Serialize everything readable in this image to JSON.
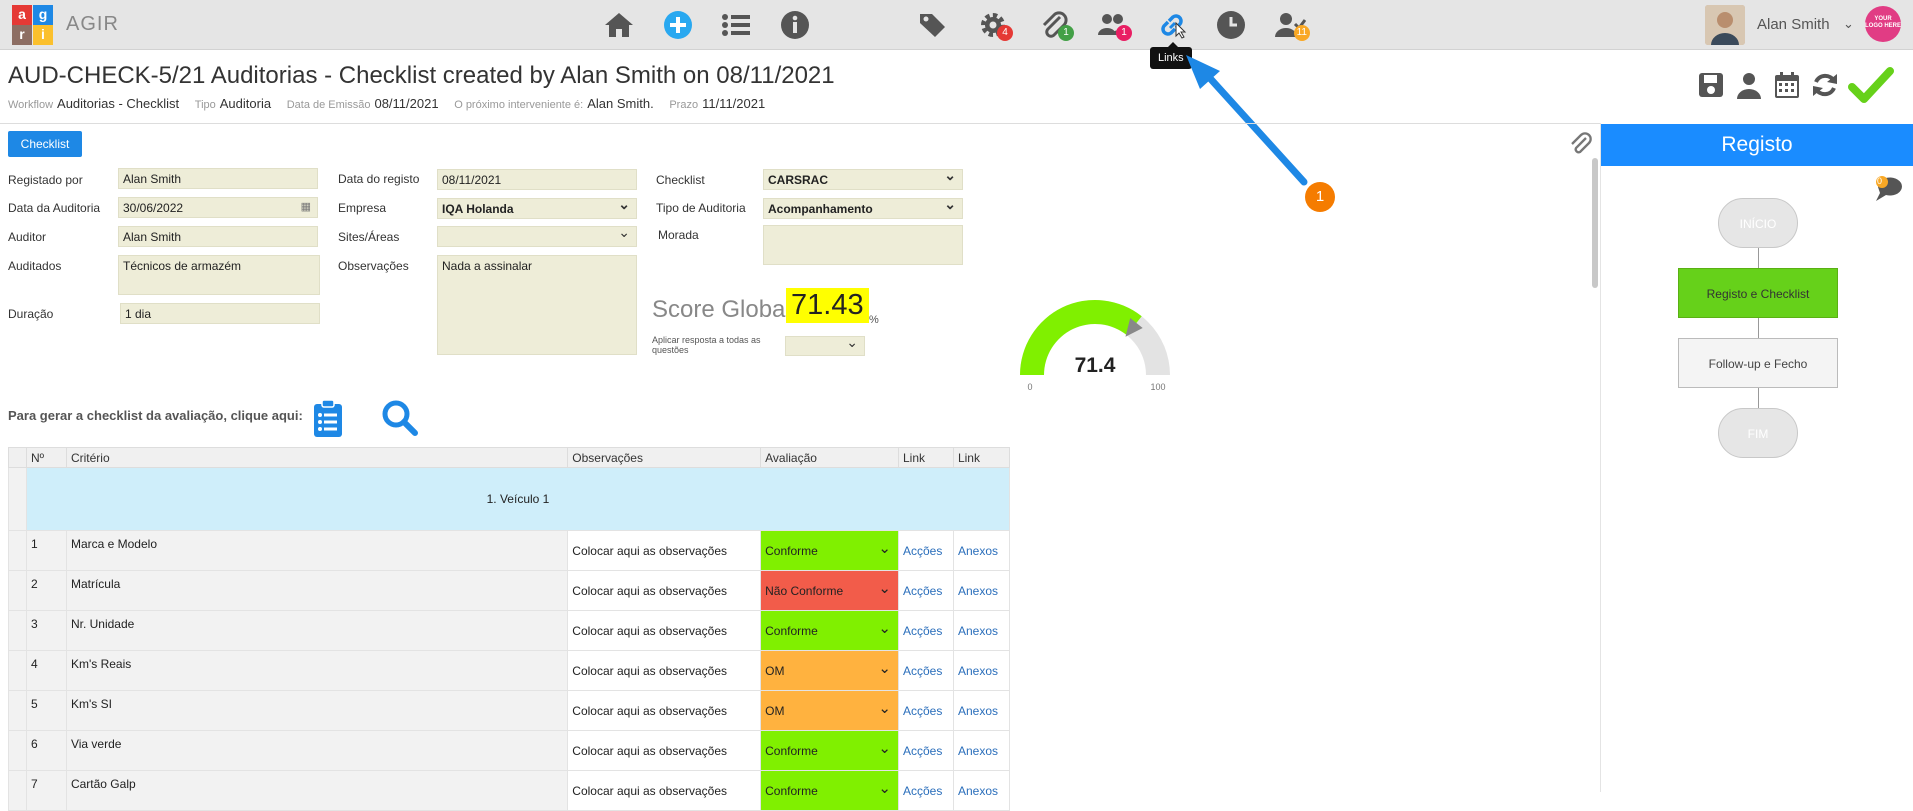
{
  "app": {
    "name": "AGIR",
    "logo_letters": [
      "a",
      "g",
      "i",
      "r"
    ]
  },
  "user": {
    "name": "Alan Smith",
    "company_logo_text": "YOUR LOGO HERE"
  },
  "toolbar": {
    "badges": {
      "settings": "4",
      "attachments": "1",
      "users": "1",
      "checklist_user": "11"
    },
    "tooltip": "Links"
  },
  "document": {
    "title": "AUD-CHECK-5/21 Auditorias - Checklist created by Alan Smith on 08/11/2021",
    "meta": [
      {
        "label": "Workflow",
        "value": "Auditorias - Checklist"
      },
      {
        "label": "Tipo",
        "value": "Auditoria"
      },
      {
        "label": "Data de Emissão",
        "value": "08/11/2021"
      },
      {
        "label": "O próximo interveniente é:",
        "value": "Alan Smith."
      },
      {
        "label": "Prazo",
        "value": "11/11/2021"
      }
    ]
  },
  "tabs": {
    "checklist": "Checklist"
  },
  "form": {
    "registado_por": {
      "label": "Registado por",
      "value": "Alan Smith"
    },
    "data_auditoria": {
      "label": "Data da Auditoria",
      "value": "30/06/2022"
    },
    "auditor": {
      "label": "Auditor",
      "value": "Alan Smith"
    },
    "auditados": {
      "label": "Auditados",
      "value": "Técnicos de armazém"
    },
    "duracao": {
      "label": "Duração",
      "value": "1 dia"
    },
    "data_registo": {
      "label": "Data do registo",
      "value": "08/11/2021"
    },
    "empresa": {
      "label": "Empresa",
      "value": "IQA Holanda"
    },
    "sites": {
      "label": "Sites/Áreas",
      "value": ""
    },
    "observacoes": {
      "label": "Observações",
      "value": "Nada a assinalar"
    },
    "checklist": {
      "label": "Checklist",
      "value": "CARSRAC"
    },
    "tipo_auditoria": {
      "label": "Tipo de Auditoria",
      "value": "Acompanhamento"
    },
    "morada": {
      "label": "Morada",
      "value": ""
    }
  },
  "score": {
    "label": "Score Global",
    "value": "71.43",
    "unit": "%",
    "apply_all_label": "Aplicar resposta a todas as questões",
    "gauge_value": "71.4",
    "gauge_fraction": 0.714,
    "gauge_min": "0",
    "gauge_max": "100"
  },
  "generate": {
    "label": "Para gerar a checklist da avaliação, clique aqui:"
  },
  "table": {
    "headers": [
      "Nº",
      "Critério",
      "Observações",
      "Avaliação",
      "Link",
      "Link"
    ],
    "group": "1. Veículo 1",
    "rows": [
      {
        "num": "1",
        "criterio": "Marca e Modelo",
        "obs": "Colocar aqui as observações",
        "aval": "Conforme",
        "color": "#80f000",
        "acc": "Acções",
        "anx": "Anexos"
      },
      {
        "num": "2",
        "criterio": "Matrícula",
        "obs": "Colocar aqui as observações",
        "aval": "Não Conforme",
        "color": "#f25c4a",
        "acc": "Acções",
        "anx": "Anexos"
      },
      {
        "num": "3",
        "criterio": "Nr. Unidade",
        "obs": "Colocar aqui as observações",
        "aval": "Conforme",
        "color": "#80f000",
        "acc": "Acções",
        "anx": "Anexos"
      },
      {
        "num": "4",
        "criterio": "Km's Reais",
        "obs": "Colocar aqui as observações",
        "aval": "OM",
        "color": "#ffb23f",
        "acc": "Acções",
        "anx": "Anexos"
      },
      {
        "num": "5",
        "criterio": "Km's SI",
        "obs": "Colocar aqui as observações",
        "aval": "OM",
        "color": "#ffb23f",
        "acc": "Acções",
        "anx": "Anexos"
      },
      {
        "num": "6",
        "criterio": "Via verde",
        "obs": "Colocar aqui as observações",
        "aval": "Conforme",
        "color": "#80f000",
        "acc": "Acções",
        "anx": "Anexos"
      },
      {
        "num": "7",
        "criterio": "Cartão Galp",
        "obs": "Colocar aqui as observações",
        "aval": "Conforme",
        "color": "#80f000",
        "acc": "Acções",
        "anx": "Anexos"
      }
    ]
  },
  "workflow": {
    "title": "Registo",
    "chat_count": "0",
    "nodes": [
      "INÍCIO",
      "Registo e Checklist",
      "Follow-up e Fecho",
      "FIM"
    ]
  },
  "annotation": {
    "step": "1"
  }
}
